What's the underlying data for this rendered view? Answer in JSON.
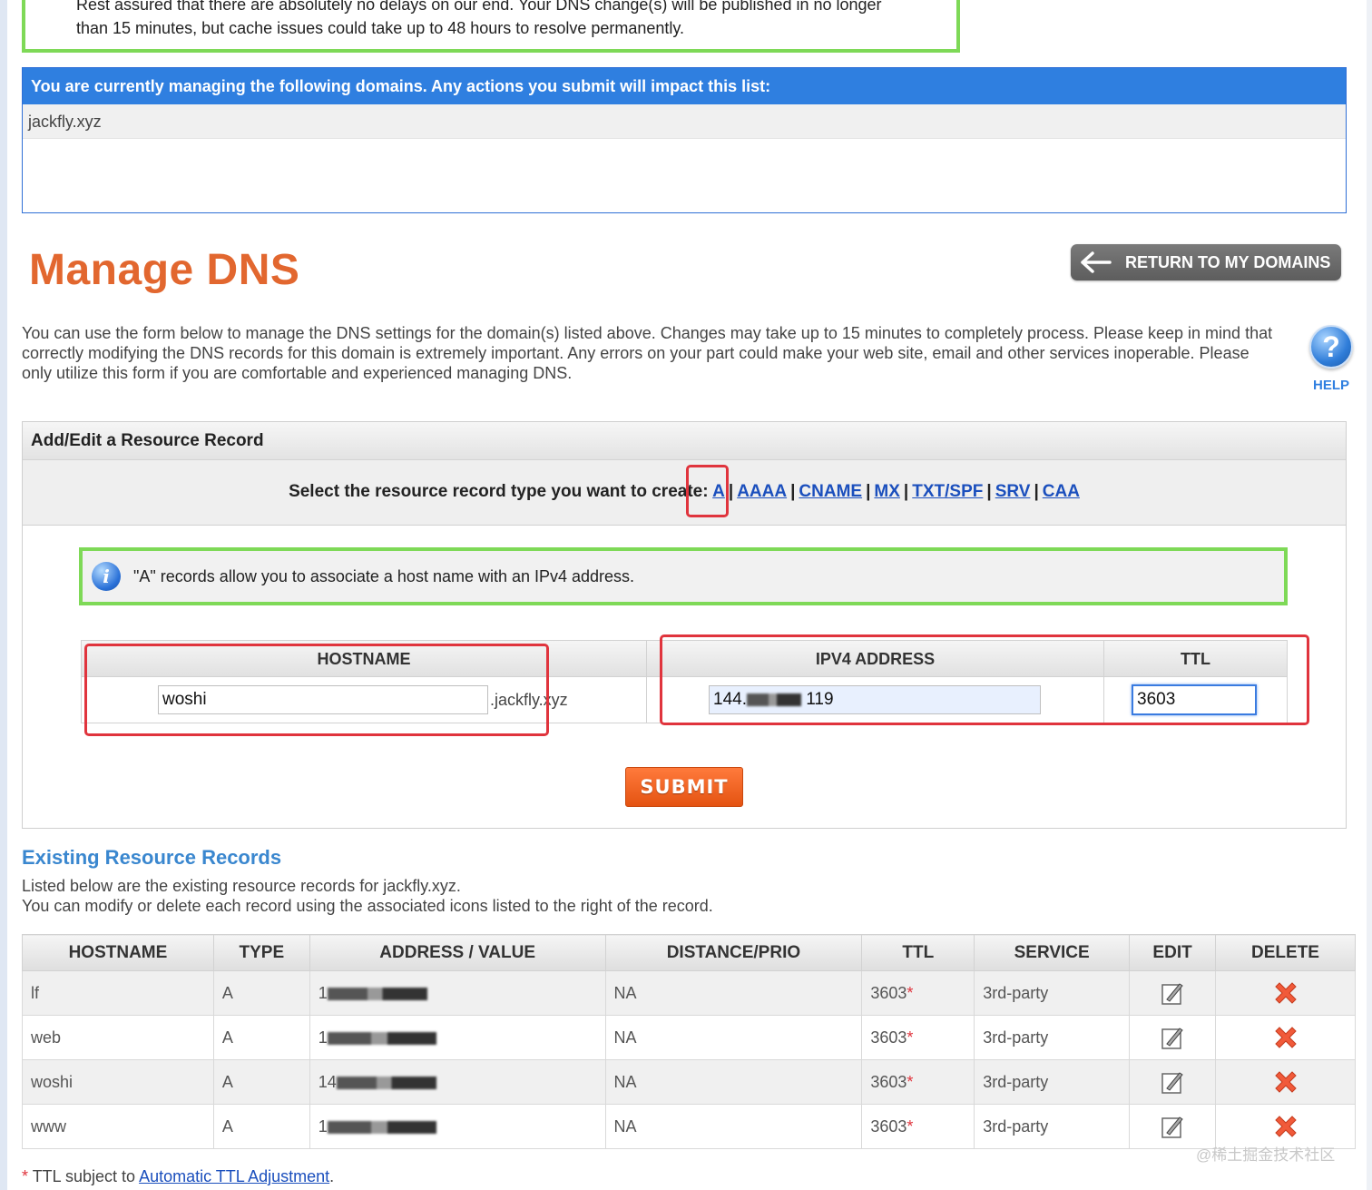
{
  "notice": {
    "line1": "Rest assured that there are absolutely no delays on our end. Your DNS change(s) will be published in no longer",
    "line2": "than 15 minutes, but cache issues could take up to 48 hours to resolve permanently."
  },
  "domains": {
    "header": "You are currently managing the following domains. Any actions you submit will impact this list:",
    "items": [
      "jackfly.xyz"
    ]
  },
  "page": {
    "title": "Manage DNS",
    "return_label": "RETURN TO MY DOMAINS",
    "intro": "You can use the form below to manage the DNS settings for the domain(s) listed above. Changes may take up to 15 minutes to completely process. Please keep in mind that correctly modifying the DNS records for this domain is extremely important. Any errors on your part could make your web site, email and other services inoperable. Please only utilize this form if you are comfortable and experienced managing DNS.",
    "help_label": "HELP"
  },
  "add_edit": {
    "title": "Add/Edit a Resource Record",
    "select_prompt": "Select the resource record type you want to create:",
    "types": [
      "A",
      "AAAA",
      "CNAME",
      "MX",
      "TXT/SPF",
      "SRV",
      "CAA"
    ],
    "info": "\"A\" records allow you to associate a host name with an IPv4 address.",
    "col_hostname": "HOSTNAME",
    "col_ipv4": "IPV4 ADDRESS",
    "col_ttl": "TTL",
    "hostname_value": "woshi",
    "hostname_suffix": ".jackfly.xyz",
    "ipv4_prefix": "144.",
    "ipv4_suffix": "119",
    "ttl_value": "3603",
    "submit_label": "SUBMIT"
  },
  "existing": {
    "title": "Existing Resource Records",
    "desc1": "Listed below are the existing resource records for jackfly.xyz.",
    "desc2": "You can modify or delete each record using the associated icons listed to the right of the record.",
    "columns": [
      "HOSTNAME",
      "TYPE",
      "ADDRESS / VALUE",
      "DISTANCE/PRIO",
      "TTL",
      "SERVICE",
      "EDIT",
      "DELETE"
    ],
    "rows": [
      {
        "host": "lf",
        "type": "A",
        "addr_prefix": "1",
        "prio": "NA",
        "ttl": "3603",
        "service": "3rd-party"
      },
      {
        "host": "web",
        "type": "A",
        "addr_prefix": "1",
        "prio": "NA",
        "ttl": "3603",
        "service": "3rd-party"
      },
      {
        "host": "woshi",
        "type": "A",
        "addr_prefix": "14",
        "prio": "NA",
        "ttl": "3603",
        "service": "3rd-party"
      },
      {
        "host": "www",
        "type": "A",
        "addr_prefix": "1",
        "prio": "NA",
        "ttl": "3603",
        "service": "3rd-party"
      }
    ],
    "ttl_asterisk": "*"
  },
  "footnote": {
    "asterisk": "*",
    "text": " TTL subject to ",
    "link": "Automatic TTL Adjustment",
    "end": "."
  },
  "watermark": "@稀土掘金技术社区",
  "colors": {
    "accent_blue": "#2f7fe0",
    "title_orange": "#e2672f",
    "highlight_red": "#e0343d",
    "highlight_green": "#7ed957",
    "submit_orange": "#ff7a3c"
  }
}
